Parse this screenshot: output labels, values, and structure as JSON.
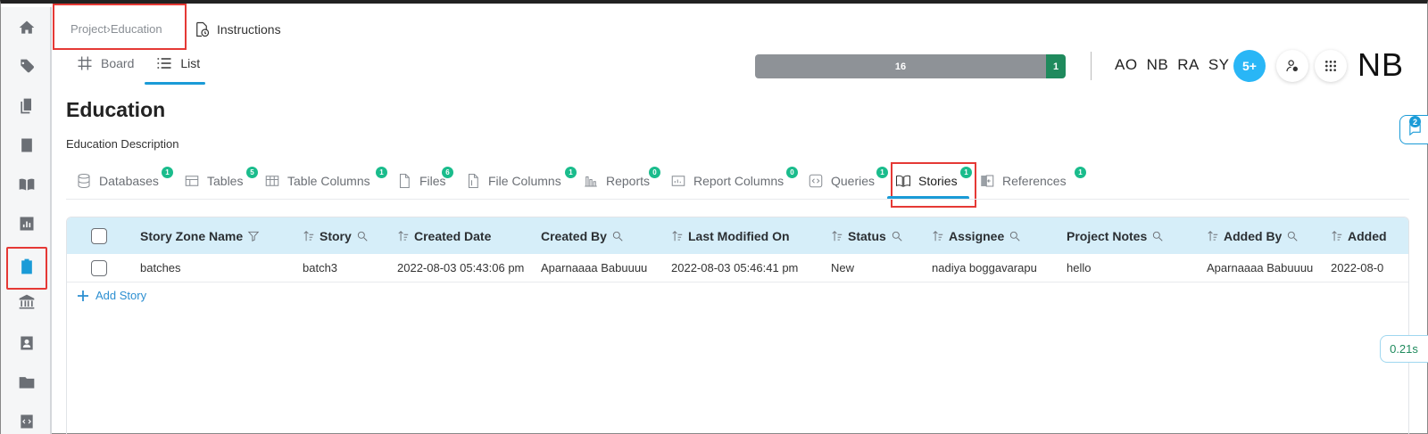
{
  "breadcrumb": {
    "project": "Project",
    "separator": "›",
    "current": "Education"
  },
  "instructions_label": "Instructions",
  "view_tabs": [
    {
      "label": "Board",
      "icon": "hash-icon",
      "active": false
    },
    {
      "label": "List",
      "icon": "list-icon",
      "active": true
    }
  ],
  "progress": {
    "grey_value": "16",
    "green_value": "1",
    "grey_color": "#8e9297",
    "green_color": "#1f8a5d"
  },
  "users": {
    "initials": [
      "AO",
      "NB",
      "RA",
      "SY"
    ],
    "more": "5+",
    "current_user": "NB"
  },
  "page": {
    "title": "Education",
    "description": "Education Description"
  },
  "tabs": [
    {
      "label": "Databases",
      "count": "1",
      "icon": "database-icon"
    },
    {
      "label": "Tables",
      "count": "5",
      "icon": "table-icon"
    },
    {
      "label": "Table Columns",
      "count": "1",
      "icon": "table-columns-icon"
    },
    {
      "label": "Files",
      "count": "6",
      "icon": "file-icon"
    },
    {
      "label": "File Columns",
      "count": "1",
      "icon": "file-columns-icon"
    },
    {
      "label": "Reports",
      "count": "0",
      "icon": "reports-icon"
    },
    {
      "label": "Report Columns",
      "count": "0",
      "icon": "report-columns-icon"
    },
    {
      "label": "Queries",
      "count": "1",
      "icon": "code-icon"
    },
    {
      "label": "Stories",
      "count": "1",
      "icon": "book-icon",
      "active": true
    },
    {
      "label": "References",
      "count": "1",
      "icon": "reference-icon"
    }
  ],
  "table": {
    "columns": [
      "Story Zone Name",
      "Story",
      "Created Date",
      "Created By",
      "Last Modified On",
      "Status",
      "Assignee",
      "Project Notes",
      "Added By",
      "Added"
    ],
    "rows": [
      {
        "story_zone_name": "batches",
        "story": "batch3",
        "created_date": "2022-08-03 05:43:06 pm",
        "created_by": "Aparnaaaa Babuuuu",
        "last_modified_on": "2022-08-03 05:46:41 pm",
        "status": "New",
        "assignee": "nadiya boggavarapu",
        "project_notes": "hello",
        "added_by": "Aparnaaaa Babuuuu",
        "added": "2022-08-0"
      }
    ],
    "add_label": "Add Story"
  },
  "notifications_count": "2",
  "timer": "0.21s",
  "colors": {
    "accent": "#1a9bd7",
    "badge": "#1abc8c",
    "header_bg": "#d6eef9",
    "highlight": "#e53935"
  }
}
